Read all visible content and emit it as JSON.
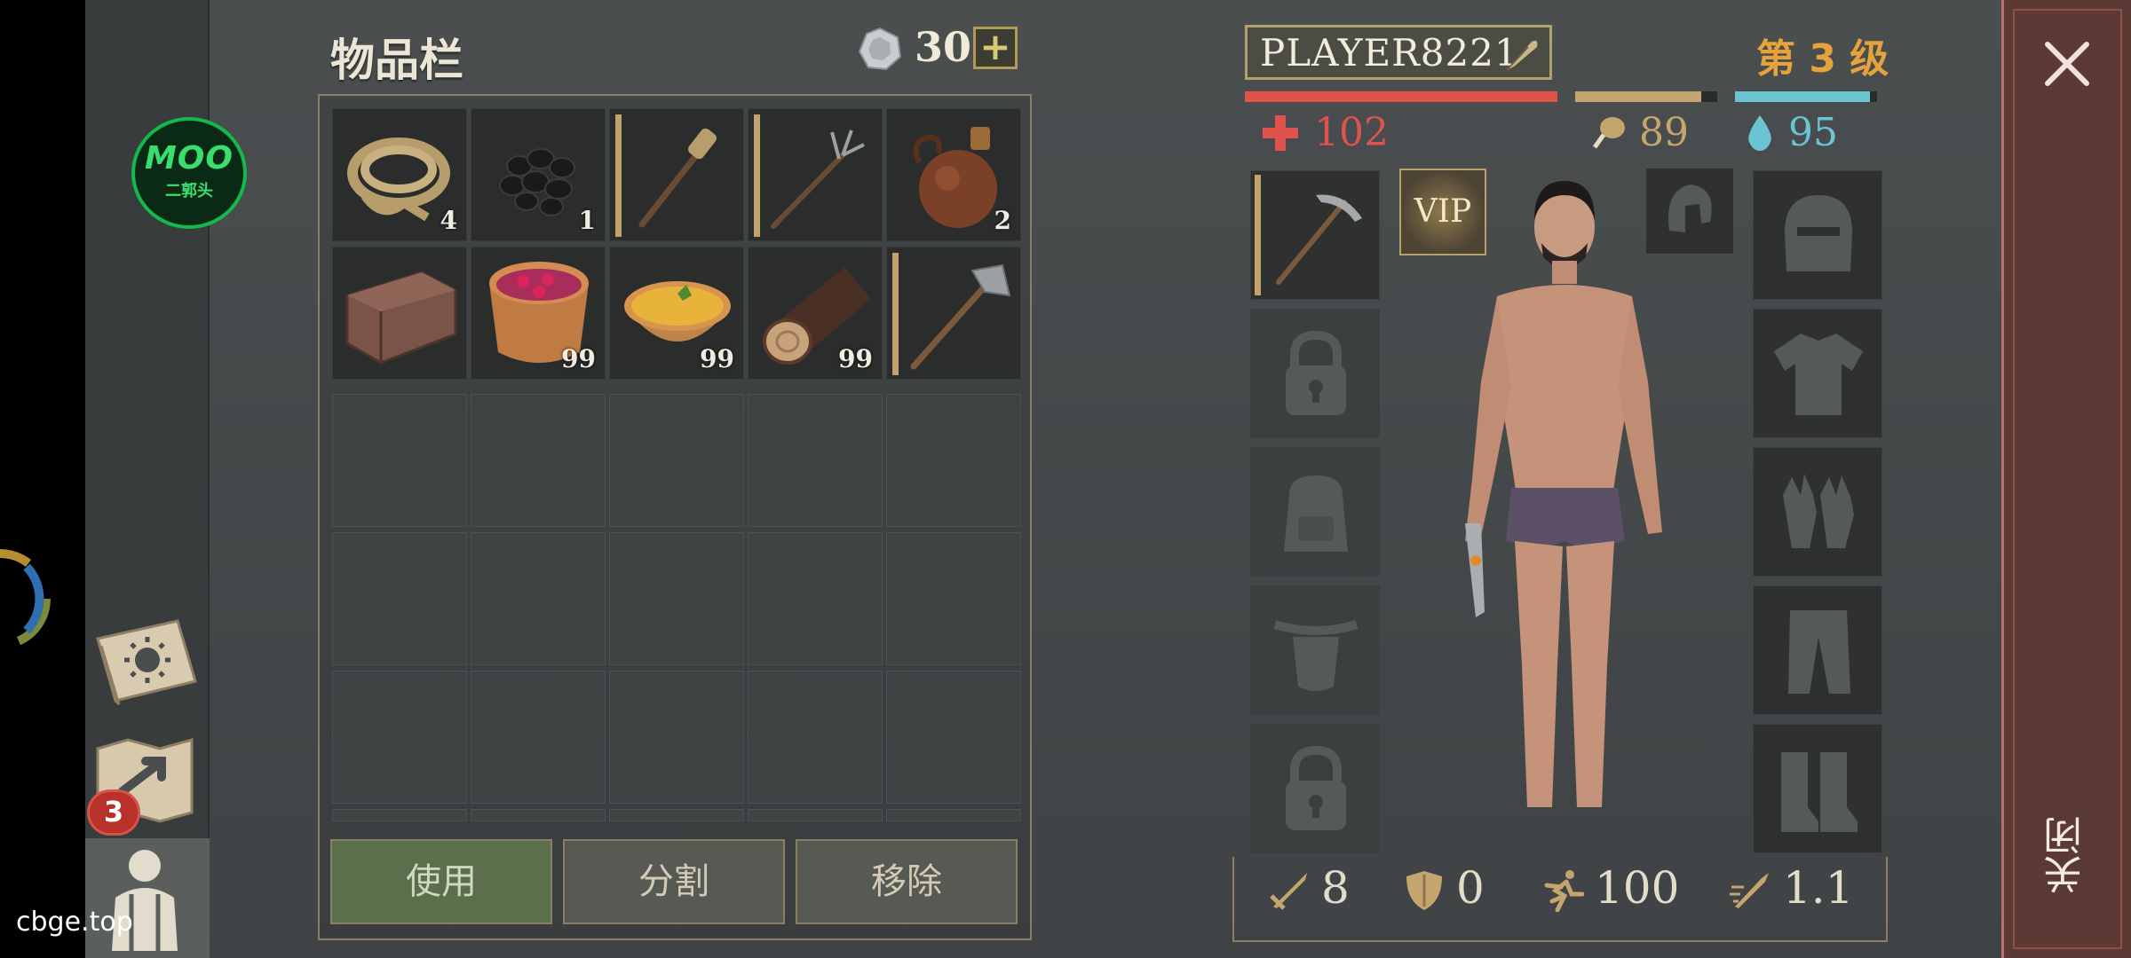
{
  "inventory": {
    "title": "物品栏",
    "coins": "30",
    "coin_add_label": "+",
    "items": [
      {
        "name": "rope",
        "qty": "4"
      },
      {
        "name": "coal",
        "qty": "1"
      },
      {
        "name": "torch",
        "qty": ""
      },
      {
        "name": "pitchfork",
        "qty": ""
      },
      {
        "name": "flask",
        "qty": "2"
      },
      {
        "name": "wooden-chest",
        "qty": ""
      },
      {
        "name": "berry-bowl",
        "qty": "99"
      },
      {
        "name": "soup-bowl",
        "qty": "99"
      },
      {
        "name": "log",
        "qty": "99"
      },
      {
        "name": "hatchet",
        "qty": ""
      }
    ],
    "actions": {
      "use": "使用",
      "split": "分割",
      "remove": "移除"
    }
  },
  "player": {
    "name": "PLAYER8221",
    "level": "第 3 级",
    "health": "102",
    "food": "89",
    "water": "95",
    "health_bar": 1.0,
    "food_bar": 0.89,
    "water_bar": 0.95,
    "colors": {
      "health": "#e0524c",
      "food": "#c5a56e",
      "water": "#6bc4d1",
      "level": "#e6a23c"
    }
  },
  "equipment": {
    "vip_label": "VIP",
    "left_slots": [
      "pickaxe-icon",
      "lock-icon",
      "backpack-icon",
      "pouch-icon",
      "lock-icon"
    ],
    "right_slots": [
      "helmet-icon",
      "shirt-icon",
      "gloves-icon",
      "pants-icon",
      "boots-icon"
    ]
  },
  "stats": {
    "attack": "8",
    "defense": "0",
    "speed": "100",
    "attack_speed": "1.1"
  },
  "sidebar": {
    "logo_top": "MOO",
    "logo_bottom": "二郭头",
    "map_badge": "3"
  },
  "close_label": "关闭",
  "watermark": "cbge.top"
}
